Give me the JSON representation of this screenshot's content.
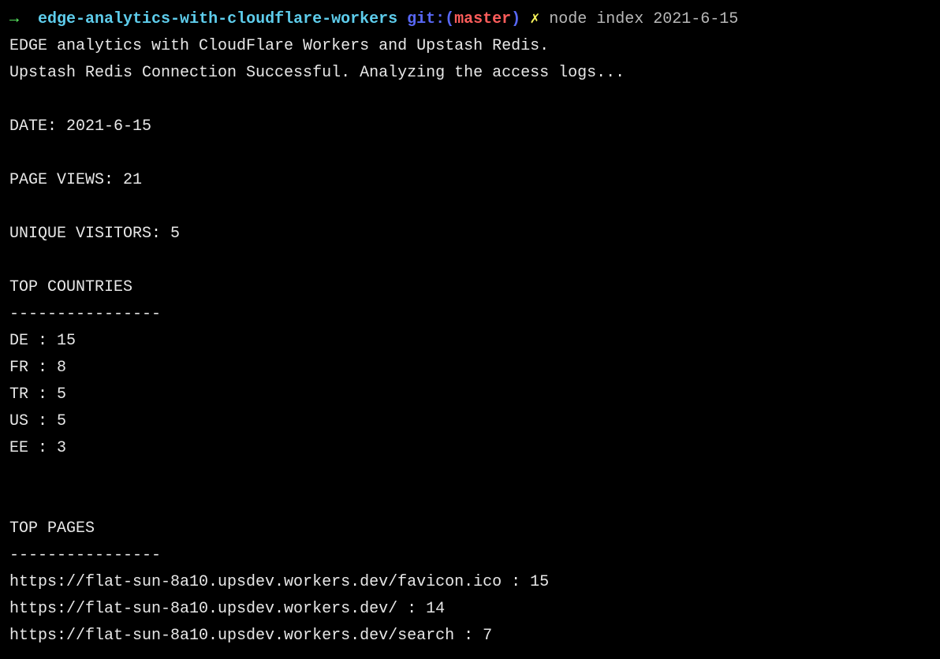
{
  "prompt": {
    "arrow": "→",
    "directory": "edge-analytics-with-cloudflare-workers",
    "git_label": "git:",
    "paren_open": "(",
    "branch": "master",
    "paren_close": ")",
    "x": "✗",
    "command": "node index 2021-6-15"
  },
  "output": {
    "line1": "EDGE analytics with CloudFlare Workers and Upstash Redis.",
    "line2": "Upstash Redis Connection Successful. Analyzing the access logs...",
    "date_label": "DATE: ",
    "date_value": "2021-6-15",
    "pv_label": "PAGE VIEWS: ",
    "pv_value": "21",
    "uv_label": "UNIQUE VISITORS: ",
    "uv_value": "5",
    "tc_header": "TOP COUNTRIES",
    "tc_divider": "----------------",
    "countries": [
      "DE : 15",
      "FR : 8",
      "TR : 5",
      "US : 5",
      "EE : 3"
    ],
    "tp_header": "TOP PAGES",
    "tp_divider": "----------------",
    "pages": [
      "https://flat-sun-8a10.upsdev.workers.dev/favicon.ico : 15",
      "https://flat-sun-8a10.upsdev.workers.dev/ : 14",
      "https://flat-sun-8a10.upsdev.workers.dev/search : 7"
    ]
  }
}
